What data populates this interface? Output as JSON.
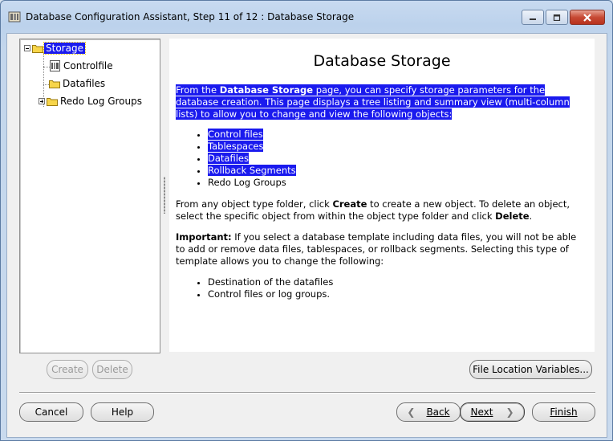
{
  "window": {
    "title": "Database Configuration Assistant, Step 11 of 12 : Database Storage"
  },
  "tree": {
    "root": "Storage",
    "items": [
      {
        "label": "Controlfile"
      },
      {
        "label": "Datafiles"
      },
      {
        "label": "Redo Log Groups"
      }
    ]
  },
  "content": {
    "title": "Database Storage",
    "intro": {
      "before": "From the ",
      "bold": "Database Storage",
      "after": " page, you can specify storage parameters for the database creation. This page displays a tree listing and summary view (multi-column lists) to allow you to change and view the following objects:"
    },
    "objects": [
      {
        "label": "Control files",
        "highlighted": true
      },
      {
        "label": "Tablespaces",
        "highlighted": true
      },
      {
        "label": "Datafiles",
        "highlighted": true
      },
      {
        "label": "Rollback Segments",
        "highlighted": true
      },
      {
        "label": "Redo Log Groups",
        "highlighted": false
      }
    ],
    "create_para": {
      "t1": "From any object type folder, click ",
      "b1": "Create",
      "t2": " to create a new object. To delete an object, select the specific object from within the object type folder and click ",
      "b2": "Delete",
      "t3": "."
    },
    "important_para": {
      "bold": "Important:",
      "text": " If you select a database template including data files, you will not be able to add or remove data files, tablespaces, or rollback segments. Selecting this type of template allows you to change the following:"
    },
    "changeable": [
      "Destination of the datafiles",
      "Control files or log groups."
    ]
  },
  "buttons": {
    "create": "Create",
    "delete": "Delete",
    "file_location": "File Location Variables...",
    "cancel": "Cancel",
    "help": "Help",
    "back": "Back",
    "next": "Next",
    "finish": "Finish"
  },
  "colors": {
    "selection": "#1a1aee",
    "close_button": "#c74a34"
  }
}
